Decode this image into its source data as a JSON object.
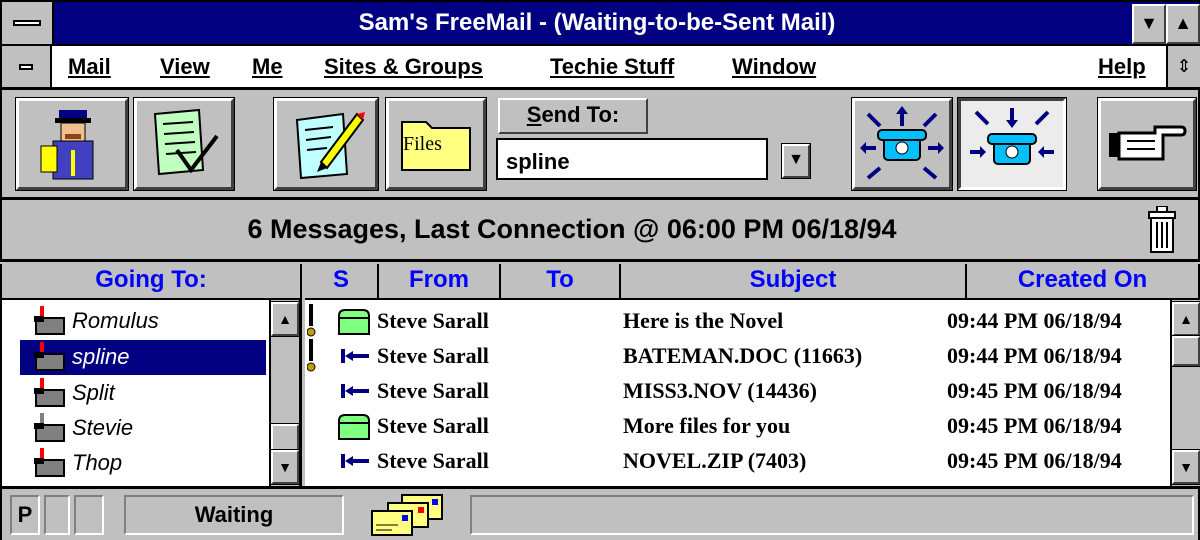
{
  "window": {
    "title": "Sam's FreeMail  - (Waiting-to-be-Sent Mail)"
  },
  "menu": {
    "items": [
      {
        "label": "Mail",
        "accel": "M"
      },
      {
        "label": "View",
        "accel": "V"
      },
      {
        "label": "Me",
        "accel": "e"
      },
      {
        "label": "Sites & Groups",
        "accel": "S"
      },
      {
        "label": "Techie Stuff",
        "accel": "T"
      },
      {
        "label": "Window",
        "accel": "W"
      },
      {
        "label": "Help",
        "accel": "H"
      }
    ]
  },
  "toolbar": {
    "files_label": "Files",
    "send_to_label": "Send To:",
    "send_to_value": "spline"
  },
  "status": {
    "summary": "6 Messages, Last Connection @ 06:00 PM 06/18/94"
  },
  "going_to": {
    "header": "Going To:",
    "items": [
      {
        "name": "Romulus",
        "selected": false
      },
      {
        "name": "spline",
        "selected": true
      },
      {
        "name": "Split",
        "selected": false
      },
      {
        "name": "Stevie",
        "selected": false
      },
      {
        "name": "Thop",
        "selected": false
      }
    ]
  },
  "messages": {
    "headers": {
      "s": "S",
      "from": "From",
      "to": "To",
      "subject": "Subject",
      "created": "Created On"
    },
    "rows": [
      {
        "attached": true,
        "type": "envelope",
        "from": "Steve Sarall",
        "subject": "Here is the Novel",
        "created": "09:44 PM 06/18/94"
      },
      {
        "attached": true,
        "type": "file",
        "from": "Steve Sarall",
        "subject": "BATEMAN.DOC (11663)",
        "created": "09:44 PM 06/18/94"
      },
      {
        "attached": false,
        "type": "file",
        "from": "Steve Sarall",
        "subject": "MISS3.NOV (14436)",
        "created": "09:45 PM 06/18/94"
      },
      {
        "attached": false,
        "type": "envelope",
        "from": "Steve Sarall",
        "subject": "More files for you",
        "created": "09:45 PM 06/18/94"
      },
      {
        "attached": false,
        "type": "file",
        "from": "Steve Sarall",
        "subject": "NOVEL.ZIP (7403)",
        "created": "09:45 PM 06/18/94"
      }
    ]
  },
  "statusbar": {
    "mode": "P",
    "state": "Waiting"
  },
  "colors": {
    "title_bg": "#000080",
    "header_text": "#0000ff",
    "selection_bg": "#000080",
    "face": "#c0c0c0"
  }
}
